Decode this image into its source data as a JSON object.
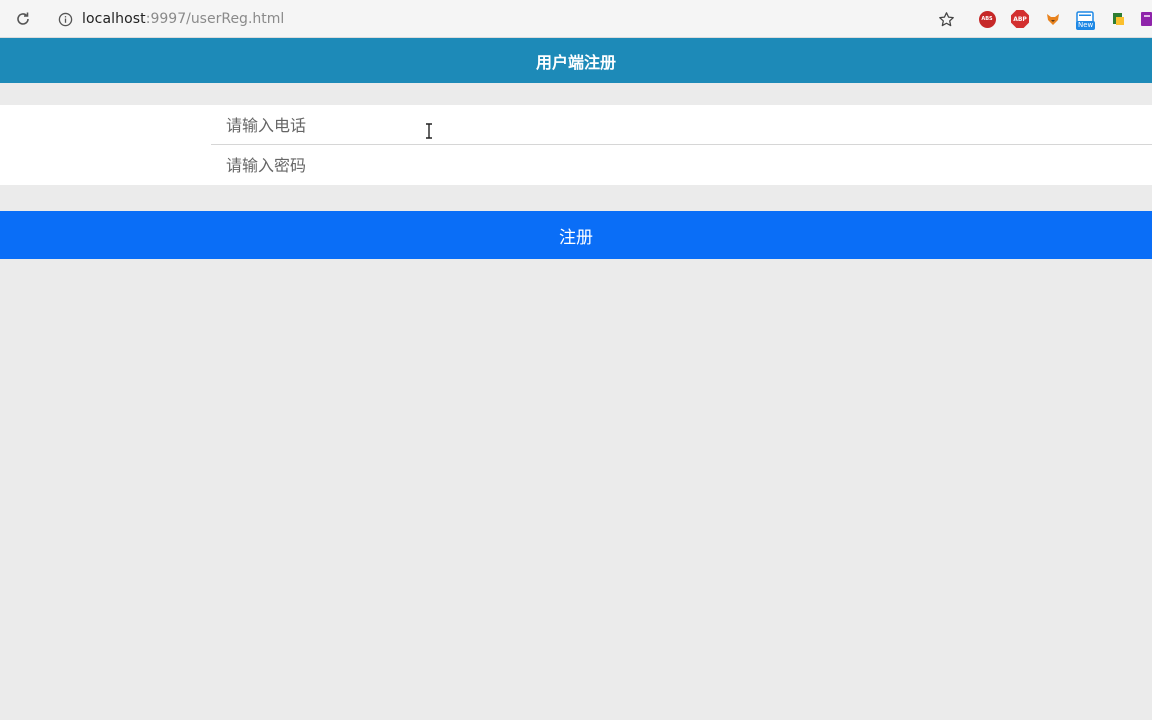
{
  "browser": {
    "url_host": "localhost",
    "url_path": ":9997/userReg.html",
    "extensions": [
      {
        "name": "shield-extension",
        "label": "ABS"
      },
      {
        "name": "adblock-plus-extension",
        "label": "ABP"
      },
      {
        "name": "fox-extension",
        "label": ""
      },
      {
        "name": "new-extension",
        "label": "New"
      },
      {
        "name": "puzzle-extension",
        "label": ""
      },
      {
        "name": "purple-extension",
        "label": ""
      }
    ]
  },
  "header": {
    "title": "用户端注册"
  },
  "form": {
    "phone_placeholder": "请输入电话",
    "password_placeholder": "请输入密码",
    "submit_label": "注册"
  },
  "colors": {
    "header_bg": "#1d8ab8",
    "button_bg": "#0a6ef7",
    "page_bg": "#ebebeb"
  }
}
